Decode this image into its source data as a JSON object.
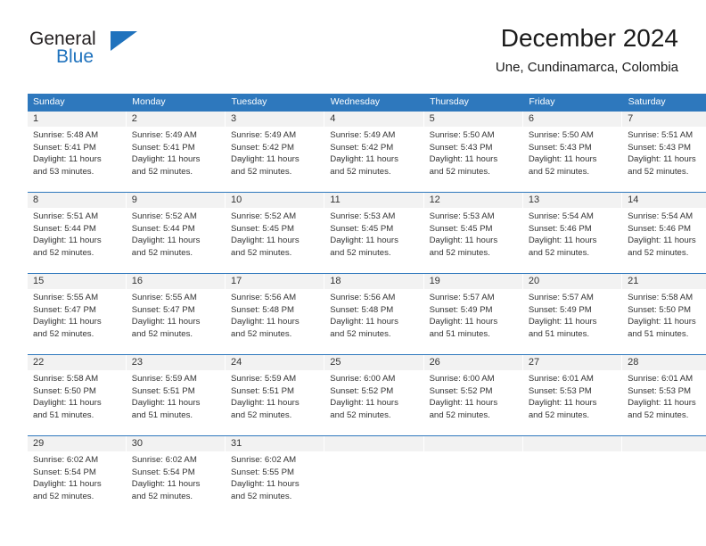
{
  "brand": {
    "name_top": "General",
    "name_bottom": "Blue",
    "accent_color": "#1f72bd"
  },
  "header": {
    "title": "December 2024",
    "subtitle": "Une, Cundinamarca, Colombia"
  },
  "calendar": {
    "header_bg": "#2e78bd",
    "daynum_bg": "#f2f2f2",
    "weekdays": [
      "Sunday",
      "Monday",
      "Tuesday",
      "Wednesday",
      "Thursday",
      "Friday",
      "Saturday"
    ],
    "weeks": [
      [
        {
          "day": "1",
          "sunrise": "Sunrise: 5:48 AM",
          "sunset": "Sunset: 5:41 PM",
          "daylight_line1": "Daylight: 11 hours",
          "daylight_line2": "and 53 minutes."
        },
        {
          "day": "2",
          "sunrise": "Sunrise: 5:49 AM",
          "sunset": "Sunset: 5:41 PM",
          "daylight_line1": "Daylight: 11 hours",
          "daylight_line2": "and 52 minutes."
        },
        {
          "day": "3",
          "sunrise": "Sunrise: 5:49 AM",
          "sunset": "Sunset: 5:42 PM",
          "daylight_line1": "Daylight: 11 hours",
          "daylight_line2": "and 52 minutes."
        },
        {
          "day": "4",
          "sunrise": "Sunrise: 5:49 AM",
          "sunset": "Sunset: 5:42 PM",
          "daylight_line1": "Daylight: 11 hours",
          "daylight_line2": "and 52 minutes."
        },
        {
          "day": "5",
          "sunrise": "Sunrise: 5:50 AM",
          "sunset": "Sunset: 5:43 PM",
          "daylight_line1": "Daylight: 11 hours",
          "daylight_line2": "and 52 minutes."
        },
        {
          "day": "6",
          "sunrise": "Sunrise: 5:50 AM",
          "sunset": "Sunset: 5:43 PM",
          "daylight_line1": "Daylight: 11 hours",
          "daylight_line2": "and 52 minutes."
        },
        {
          "day": "7",
          "sunrise": "Sunrise: 5:51 AM",
          "sunset": "Sunset: 5:43 PM",
          "daylight_line1": "Daylight: 11 hours",
          "daylight_line2": "and 52 minutes."
        }
      ],
      [
        {
          "day": "8",
          "sunrise": "Sunrise: 5:51 AM",
          "sunset": "Sunset: 5:44 PM",
          "daylight_line1": "Daylight: 11 hours",
          "daylight_line2": "and 52 minutes."
        },
        {
          "day": "9",
          "sunrise": "Sunrise: 5:52 AM",
          "sunset": "Sunset: 5:44 PM",
          "daylight_line1": "Daylight: 11 hours",
          "daylight_line2": "and 52 minutes."
        },
        {
          "day": "10",
          "sunrise": "Sunrise: 5:52 AM",
          "sunset": "Sunset: 5:45 PM",
          "daylight_line1": "Daylight: 11 hours",
          "daylight_line2": "and 52 minutes."
        },
        {
          "day": "11",
          "sunrise": "Sunrise: 5:53 AM",
          "sunset": "Sunset: 5:45 PM",
          "daylight_line1": "Daylight: 11 hours",
          "daylight_line2": "and 52 minutes."
        },
        {
          "day": "12",
          "sunrise": "Sunrise: 5:53 AM",
          "sunset": "Sunset: 5:45 PM",
          "daylight_line1": "Daylight: 11 hours",
          "daylight_line2": "and 52 minutes."
        },
        {
          "day": "13",
          "sunrise": "Sunrise: 5:54 AM",
          "sunset": "Sunset: 5:46 PM",
          "daylight_line1": "Daylight: 11 hours",
          "daylight_line2": "and 52 minutes."
        },
        {
          "day": "14",
          "sunrise": "Sunrise: 5:54 AM",
          "sunset": "Sunset: 5:46 PM",
          "daylight_line1": "Daylight: 11 hours",
          "daylight_line2": "and 52 minutes."
        }
      ],
      [
        {
          "day": "15",
          "sunrise": "Sunrise: 5:55 AM",
          "sunset": "Sunset: 5:47 PM",
          "daylight_line1": "Daylight: 11 hours",
          "daylight_line2": "and 52 minutes."
        },
        {
          "day": "16",
          "sunrise": "Sunrise: 5:55 AM",
          "sunset": "Sunset: 5:47 PM",
          "daylight_line1": "Daylight: 11 hours",
          "daylight_line2": "and 52 minutes."
        },
        {
          "day": "17",
          "sunrise": "Sunrise: 5:56 AM",
          "sunset": "Sunset: 5:48 PM",
          "daylight_line1": "Daylight: 11 hours",
          "daylight_line2": "and 52 minutes."
        },
        {
          "day": "18",
          "sunrise": "Sunrise: 5:56 AM",
          "sunset": "Sunset: 5:48 PM",
          "daylight_line1": "Daylight: 11 hours",
          "daylight_line2": "and 52 minutes."
        },
        {
          "day": "19",
          "sunrise": "Sunrise: 5:57 AM",
          "sunset": "Sunset: 5:49 PM",
          "daylight_line1": "Daylight: 11 hours",
          "daylight_line2": "and 51 minutes."
        },
        {
          "day": "20",
          "sunrise": "Sunrise: 5:57 AM",
          "sunset": "Sunset: 5:49 PM",
          "daylight_line1": "Daylight: 11 hours",
          "daylight_line2": "and 51 minutes."
        },
        {
          "day": "21",
          "sunrise": "Sunrise: 5:58 AM",
          "sunset": "Sunset: 5:50 PM",
          "daylight_line1": "Daylight: 11 hours",
          "daylight_line2": "and 51 minutes."
        }
      ],
      [
        {
          "day": "22",
          "sunrise": "Sunrise: 5:58 AM",
          "sunset": "Sunset: 5:50 PM",
          "daylight_line1": "Daylight: 11 hours",
          "daylight_line2": "and 51 minutes."
        },
        {
          "day": "23",
          "sunrise": "Sunrise: 5:59 AM",
          "sunset": "Sunset: 5:51 PM",
          "daylight_line1": "Daylight: 11 hours",
          "daylight_line2": "and 51 minutes."
        },
        {
          "day": "24",
          "sunrise": "Sunrise: 5:59 AM",
          "sunset": "Sunset: 5:51 PM",
          "daylight_line1": "Daylight: 11 hours",
          "daylight_line2": "and 52 minutes."
        },
        {
          "day": "25",
          "sunrise": "Sunrise: 6:00 AM",
          "sunset": "Sunset: 5:52 PM",
          "daylight_line1": "Daylight: 11 hours",
          "daylight_line2": "and 52 minutes."
        },
        {
          "day": "26",
          "sunrise": "Sunrise: 6:00 AM",
          "sunset": "Sunset: 5:52 PM",
          "daylight_line1": "Daylight: 11 hours",
          "daylight_line2": "and 52 minutes."
        },
        {
          "day": "27",
          "sunrise": "Sunrise: 6:01 AM",
          "sunset": "Sunset: 5:53 PM",
          "daylight_line1": "Daylight: 11 hours",
          "daylight_line2": "and 52 minutes."
        },
        {
          "day": "28",
          "sunrise": "Sunrise: 6:01 AM",
          "sunset": "Sunset: 5:53 PM",
          "daylight_line1": "Daylight: 11 hours",
          "daylight_line2": "and 52 minutes."
        }
      ],
      [
        {
          "day": "29",
          "sunrise": "Sunrise: 6:02 AM",
          "sunset": "Sunset: 5:54 PM",
          "daylight_line1": "Daylight: 11 hours",
          "daylight_line2": "and 52 minutes."
        },
        {
          "day": "30",
          "sunrise": "Sunrise: 6:02 AM",
          "sunset": "Sunset: 5:54 PM",
          "daylight_line1": "Daylight: 11 hours",
          "daylight_line2": "and 52 minutes."
        },
        {
          "day": "31",
          "sunrise": "Sunrise: 6:02 AM",
          "sunset": "Sunset: 5:55 PM",
          "daylight_line1": "Daylight: 11 hours",
          "daylight_line2": "and 52 minutes."
        },
        {
          "day": "",
          "sunrise": "",
          "sunset": "",
          "daylight_line1": "",
          "daylight_line2": ""
        },
        {
          "day": "",
          "sunrise": "",
          "sunset": "",
          "daylight_line1": "",
          "daylight_line2": ""
        },
        {
          "day": "",
          "sunrise": "",
          "sunset": "",
          "daylight_line1": "",
          "daylight_line2": ""
        },
        {
          "day": "",
          "sunrise": "",
          "sunset": "",
          "daylight_line1": "",
          "daylight_line2": ""
        }
      ]
    ]
  }
}
